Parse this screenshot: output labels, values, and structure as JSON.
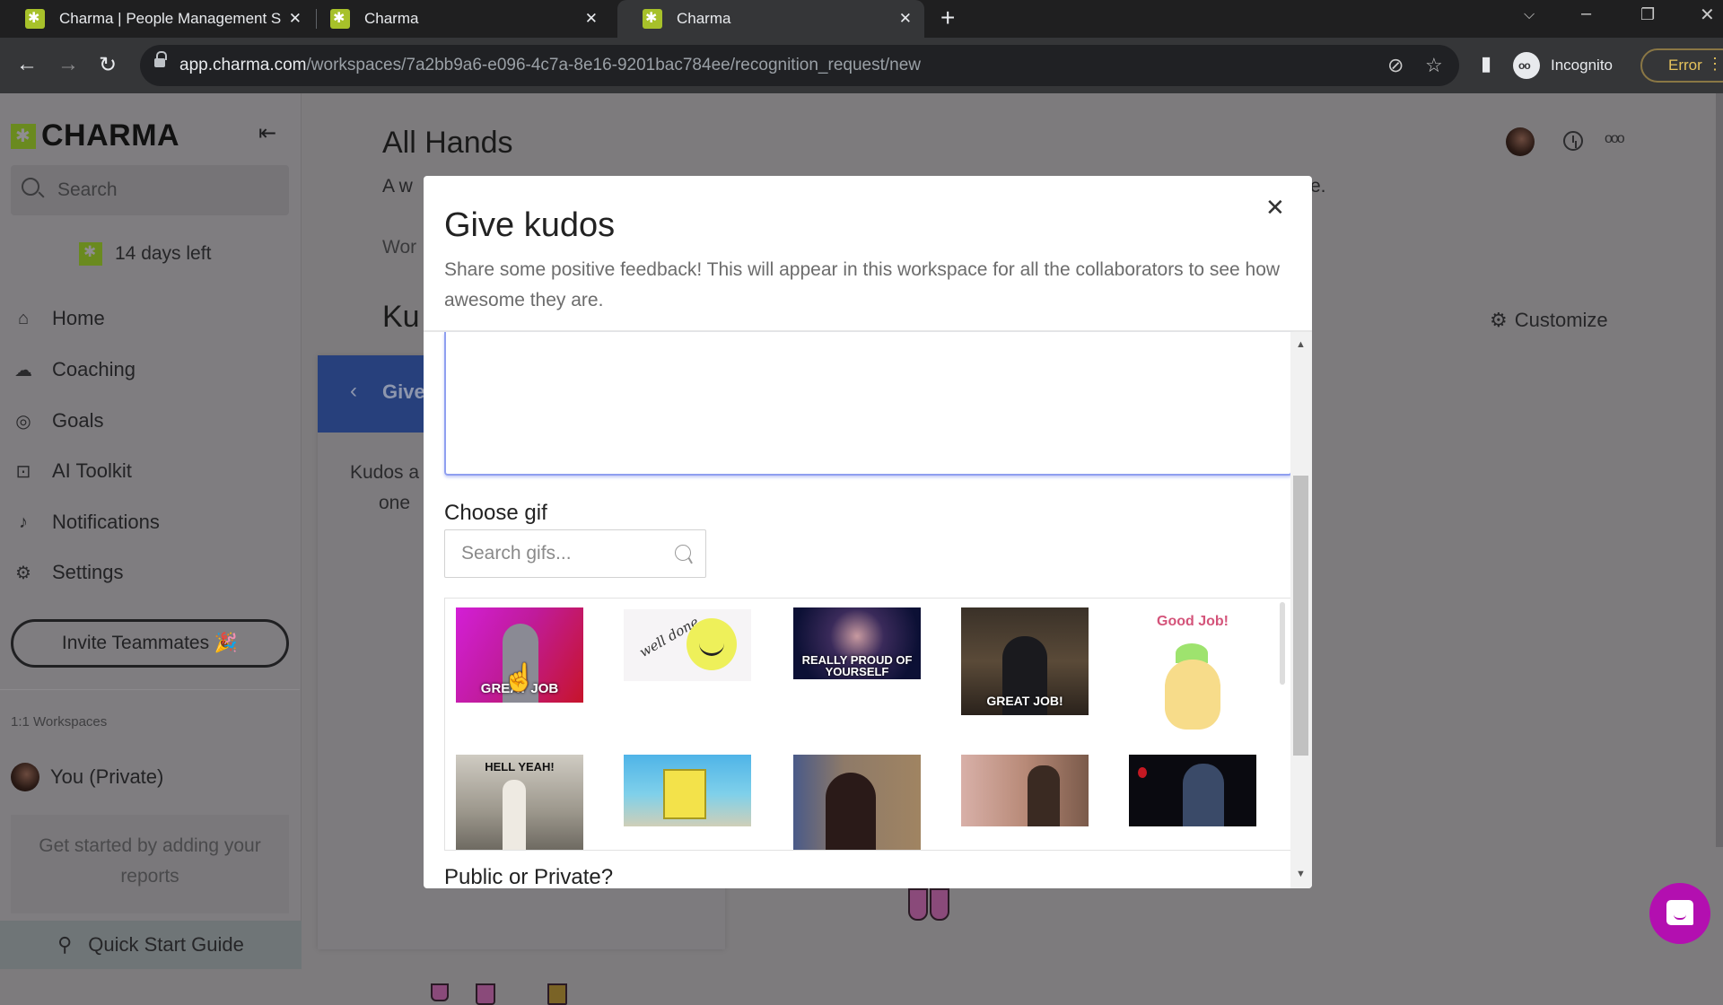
{
  "browser": {
    "tabs": [
      {
        "title": "Charma | People Management S",
        "active": false
      },
      {
        "title": "Charma",
        "active": false
      },
      {
        "title": "Charma",
        "active": true
      }
    ],
    "new_tab_label": "+",
    "url_host": "app.charma.com",
    "url_path": "/workspaces/7a2bb9a6-e096-4c7a-8e16-9201bac784ee/recognition_request/new",
    "profile_label": "Incognito",
    "error_label": "Error"
  },
  "sidebar": {
    "logo_text": "CHARMA",
    "search_placeholder": "Search",
    "trial_text": "14 days left",
    "nav": [
      {
        "label": "Home",
        "icon": "home-icon"
      },
      {
        "label": "Coaching",
        "icon": "coaching-icon"
      },
      {
        "label": "Goals",
        "icon": "goals-icon"
      },
      {
        "label": "AI Toolkit",
        "icon": "robot-icon"
      },
      {
        "label": "Notifications",
        "icon": "bell-icon"
      },
      {
        "label": "Settings",
        "icon": "gear-icon"
      }
    ],
    "invite_label": "Invite Teammates 🎉",
    "workspaces_label": "1:1 Workspaces",
    "private_workspace": "You (Private)",
    "reports_prompt": "Get started by adding your reports",
    "quick_start": "Quick Start Guide"
  },
  "main": {
    "title": "All Hands",
    "description_start": "A w",
    "description_end": "e.",
    "section_fragment": "Wor",
    "kudos_heading": "Ku",
    "customize_label": "Customize",
    "kudos_card": {
      "header": "Give",
      "text_line1": "Kudos a",
      "text_line2": "one"
    }
  },
  "modal": {
    "title": "Give kudos",
    "subtitle": "Share some positive feedback! This will appear in this workspace for all the collaborators to see how awesome they are.",
    "message_value": "",
    "choose_gif_label": "Choose gif",
    "gif_search_placeholder": "Search gifs...",
    "gifs": [
      {
        "caption": "GREAT JOB",
        "alt": "Man covering face on pink background"
      },
      {
        "caption": "well done",
        "alt": "Winking smiley with 'well done' script"
      },
      {
        "caption": "REALLY PROUD OF YOURSELF",
        "alt": "Woman on stage with blue lights"
      },
      {
        "caption": "GREAT JOB!",
        "alt": "Talk show host giving okay sign"
      },
      {
        "caption": "Good Job!",
        "alt": "Cute pineapple character"
      },
      {
        "caption": "HELL YEAH!",
        "alt": "Child dancing in black and white"
      },
      {
        "caption": "",
        "alt": "SpongeBob giving thumbs up"
      },
      {
        "caption": "",
        "alt": "Woman smiling and pointing"
      },
      {
        "caption": "",
        "alt": "Man waving in warm lit room"
      },
      {
        "caption": "",
        "alt": "Man clapping on dark stage"
      }
    ],
    "visibility_label": "Public or Private?"
  }
}
